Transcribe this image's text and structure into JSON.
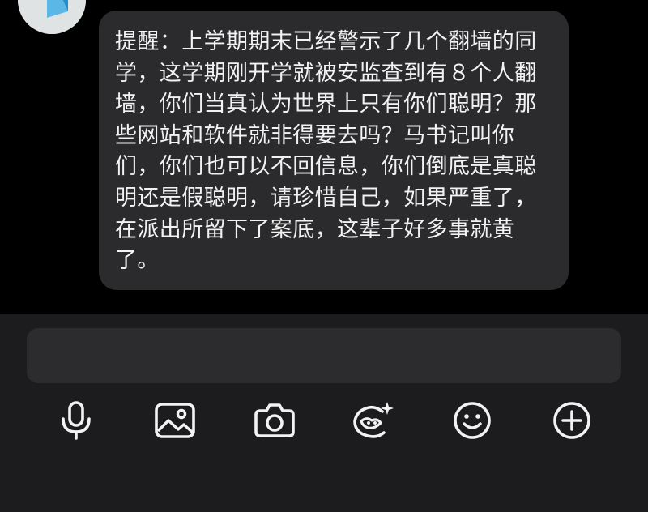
{
  "app": {
    "background_color": "#000000",
    "composer_background_color": "#1c1c1e",
    "input_background_color": "#2c2c2e",
    "bubble_background_color": "#2b2b2e",
    "text_color": "#f2f2f2",
    "icon_color": "#f2f2f2"
  },
  "message": {
    "text": "提醒：上学期期末已经警示了几个翻墙的同学，这学期刚开学就被安监查到有８个人翻墙，你们当真认为世界上只有你们聪明？那些网站和软件就非得要去吗？马书记叫你们，你们也可以不回信息，你们倒底是真聪明还是假聪明，请珍惜自己，如果严重了，在派出所留下了案底，这辈子好多事就黄了。"
  },
  "composer": {
    "input_value": "",
    "input_placeholder": ""
  },
  "toolbar": {
    "items": [
      {
        "icon": "microphone-icon"
      },
      {
        "icon": "image-icon"
      },
      {
        "icon": "camera-icon"
      },
      {
        "icon": "sticker-sparkle-icon"
      },
      {
        "icon": "emoji-icon"
      },
      {
        "icon": "plus-circle-icon"
      }
    ]
  }
}
